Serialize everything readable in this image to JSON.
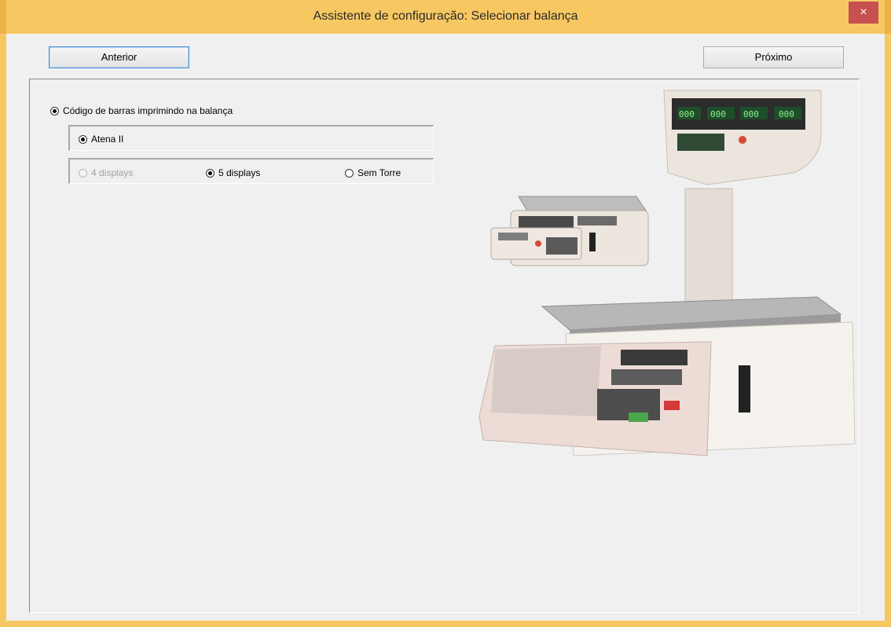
{
  "window": {
    "title": "Assistente de configuração: Selecionar balança",
    "close_glyph": "×"
  },
  "nav": {
    "previous_label": "Anterior",
    "next_label": "Próximo"
  },
  "options": {
    "barcode_label": "Código de barras imprimindo na balança",
    "model_label": "Atena II",
    "displays": [
      {
        "label": "4 displays",
        "state": "disabled"
      },
      {
        "label": "5 displays",
        "state": "checked"
      },
      {
        "label": "Sem Torre",
        "state": "unchecked"
      }
    ]
  },
  "icons": {
    "close": "close-icon",
    "scale_image": "price-computing-scale-image"
  },
  "colors": {
    "titlebar": "#f7c862",
    "close": "#c75050",
    "background": "#f0f0f0"
  },
  "scale_display": {
    "readouts": [
      "000",
      "000",
      "000",
      "000"
    ]
  }
}
